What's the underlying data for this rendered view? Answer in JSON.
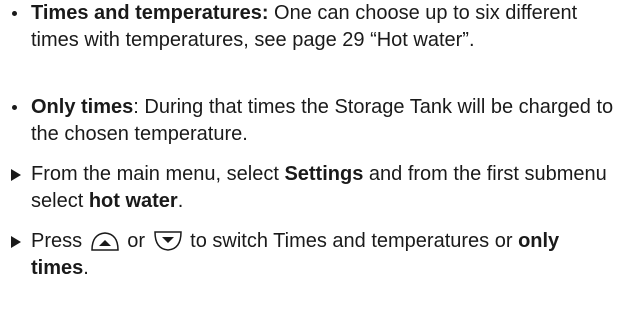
{
  "items": [
    {
      "bold": "Times and temperatures:",
      "text": " One can choose up to six different times with temperatures, see page  29 “Hot water”."
    },
    {
      "bold": "Only times",
      "text": ": During that times the Storage Tank will be charged to the chosen temperature."
    },
    {
      "t1": "From the main menu, select ",
      "b1": "Settings",
      "t2": " and from the first submenu select ",
      "b2": "hot water",
      "t3": "."
    },
    {
      "t1": "Press ",
      "t2": " or ",
      "t3": " to switch Times and temperatures or ",
      "b1": "only times",
      "t4": "."
    }
  ],
  "icons": {
    "up": "up-arrow-key-icon",
    "down": "down-arrow-key-icon"
  }
}
